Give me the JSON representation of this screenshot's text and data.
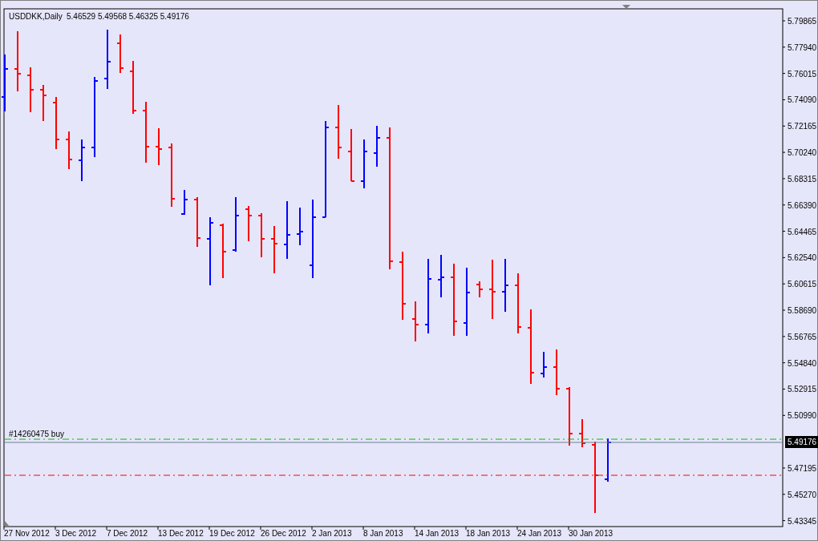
{
  "chart_header": {
    "symbol": "USDDKK,Daily",
    "ohlc": "5.46529 5.49568 5.46325 5.49176"
  },
  "order_line": {
    "label": "#14260475 buy"
  },
  "price_marker": {
    "label": "5.49176"
  },
  "price_axis": {
    "labels": [
      "5.79865",
      "5.77940",
      "5.76015",
      "5.74090",
      "5.72165",
      "5.70240",
      "5.68315",
      "5.66390",
      "5.64465",
      "5.62540",
      "5.60615",
      "5.58690",
      "5.56765",
      "5.54840",
      "5.52915",
      "5.50990",
      "5.47195",
      "5.45270",
      "5.43345"
    ]
  },
  "date_axis": {
    "labels": [
      "27 Nov 2012",
      "3 Dec 2012",
      "7 Dec 2012",
      "13 Dec 2012",
      "19 Dec 2012",
      "26 Dec 2012",
      "2 Jan 2013",
      "8 Jan 2013",
      "14 Jan 2013",
      "18 Jan 2013",
      "24 Jan 2013",
      "30 Jan 2013"
    ]
  }
}
